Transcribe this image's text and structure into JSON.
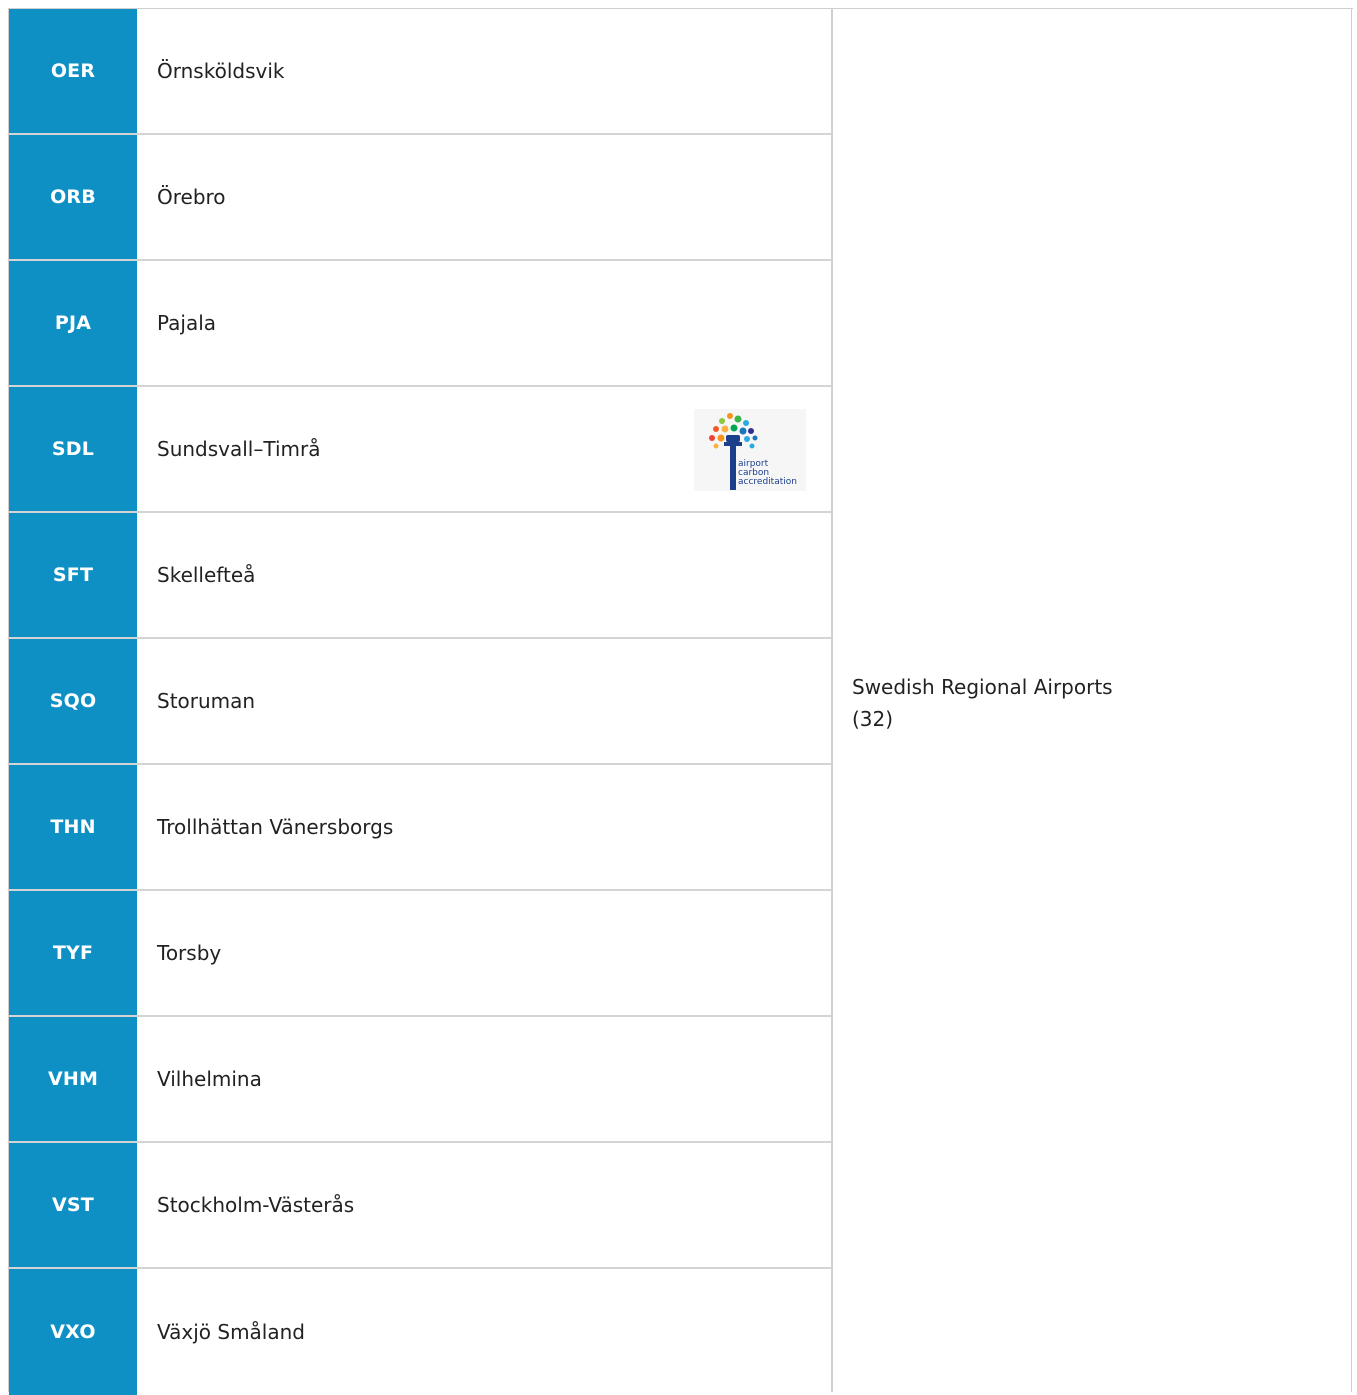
{
  "airports": [
    {
      "code": "OER",
      "name": "Örnsköldsvik"
    },
    {
      "code": "ORB",
      "name": "Örebro"
    },
    {
      "code": "PJA",
      "name": "Pajala"
    },
    {
      "code": "SDL",
      "name": "Sundsvall–Timrå",
      "badge": {
        "icon": "airport-carbon-accreditation-logo",
        "text": [
          "airport",
          "carbon",
          "accreditation"
        ]
      }
    },
    {
      "code": "SFT",
      "name": "Skellefteå"
    },
    {
      "code": "SQO",
      "name": "Storuman"
    },
    {
      "code": "THN",
      "name": "Trollhättan Vänersborgs"
    },
    {
      "code": "TYF",
      "name": "Torsby"
    },
    {
      "code": "VHM",
      "name": "Vilhelmina"
    },
    {
      "code": "VST",
      "name": "Stockholm-Västerås"
    },
    {
      "code": "VXO",
      "name": "Växjö Småland"
    }
  ],
  "group": {
    "name": "Swedish Regional Airports",
    "count": "(32)"
  },
  "colors": {
    "code_background": "#0e90c5",
    "code_text": "#ffffff",
    "border": "#d4d4d4"
  }
}
